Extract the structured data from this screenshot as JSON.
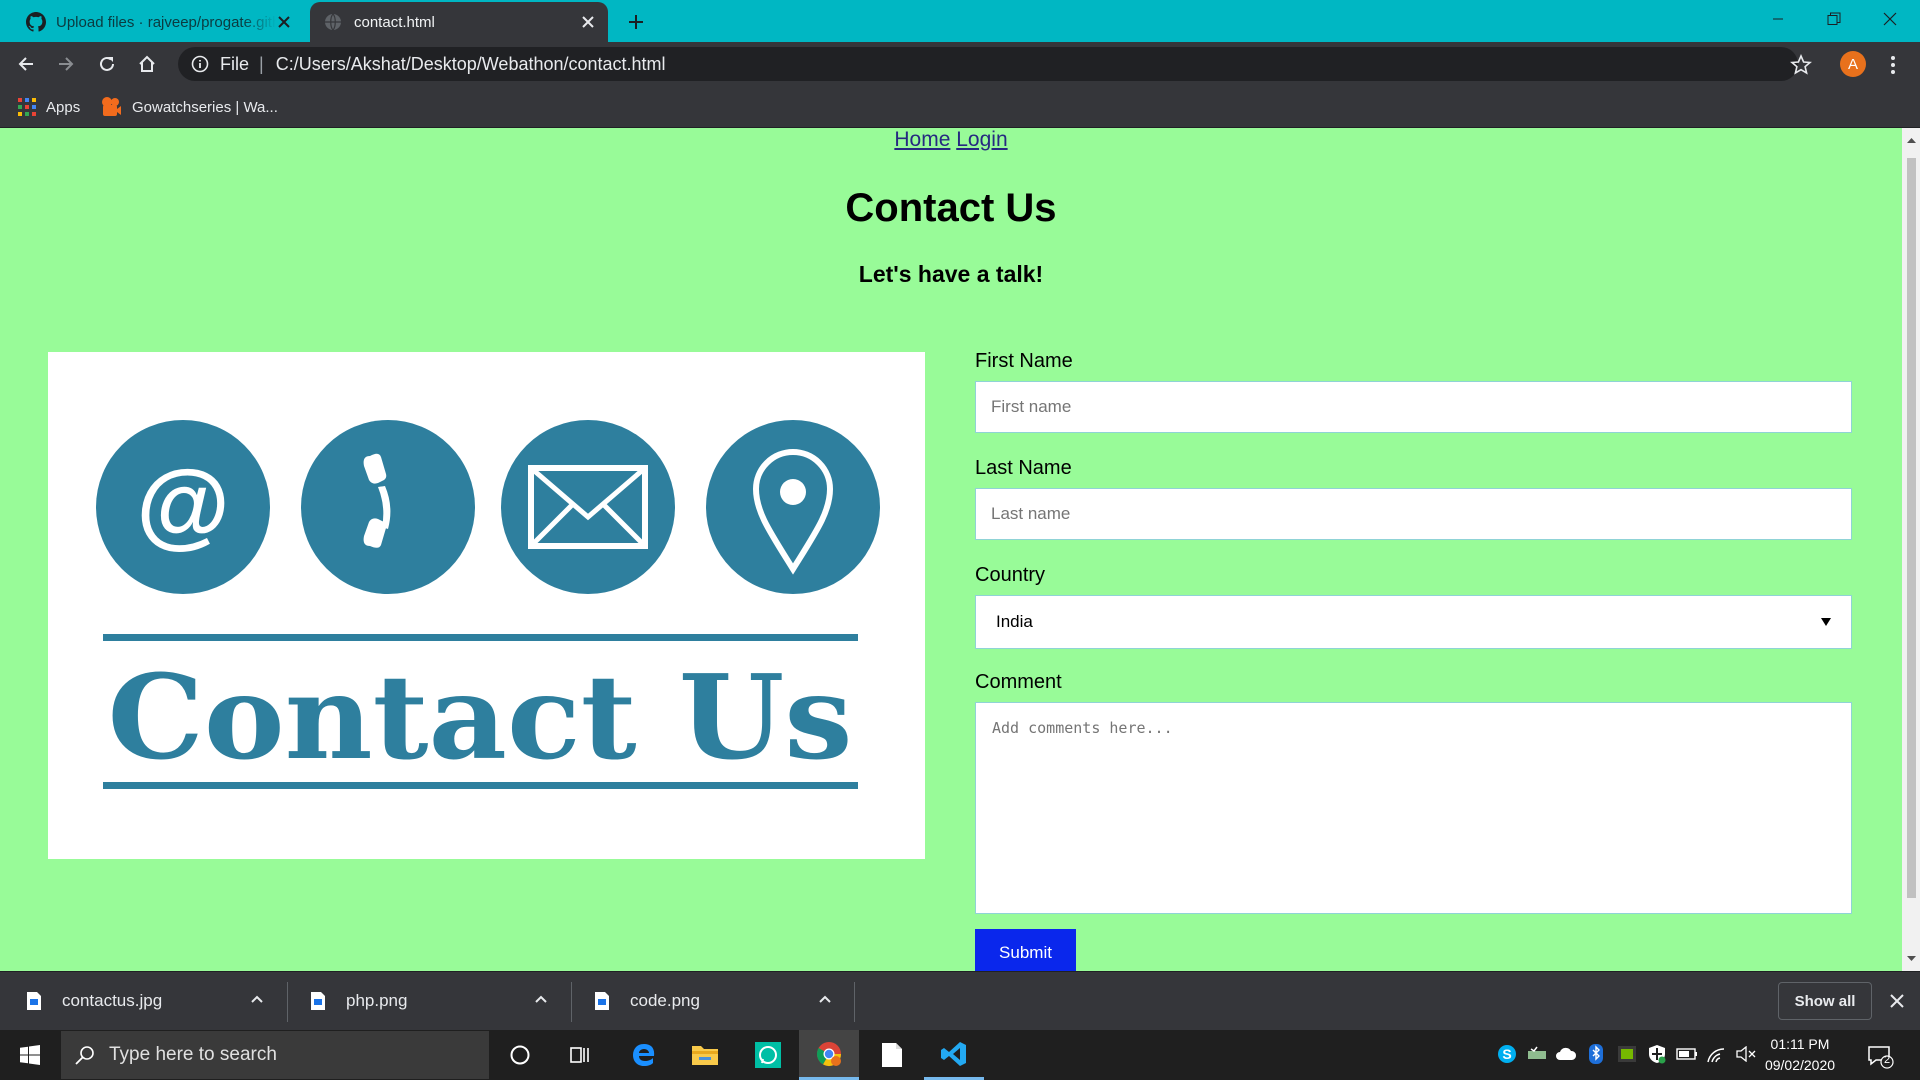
{
  "browser": {
    "tabs": [
      {
        "title": "Upload files · rajveep/progate.github.io",
        "active": false
      },
      {
        "title": "contact.html",
        "active": true
      }
    ],
    "address": {
      "scheme": "File",
      "url": "C:/Users/Akshat/Desktop/Webathon/contact.html"
    },
    "profile_initial": "A",
    "bookmarks": [
      {
        "label": "Apps",
        "icon": "apps-grid-icon"
      },
      {
        "label": "Gowatchseries | Wa...",
        "icon": "gowatchseries-icon"
      }
    ],
    "accent_color": "#00b7c3"
  },
  "page": {
    "background": "#98fb98",
    "nav": {
      "home": "Home",
      "login": "Login"
    },
    "title": "Contact Us",
    "subtitle": "Let's have a talk!",
    "image": {
      "banner_text": "Contact Us",
      "icons": [
        "at-sign-icon",
        "phone-icon",
        "envelope-icon",
        "location-pin-icon"
      ],
      "color": "#2e7f9e"
    },
    "form": {
      "first_name_label": "First Name",
      "first_name_placeholder": "First name",
      "last_name_label": "Last Name",
      "last_name_placeholder": "Last name",
      "country_label": "Country",
      "country_value": "India",
      "comment_label": "Comment",
      "comment_placeholder": "Add comments here...",
      "submit_label": "Submit"
    }
  },
  "downloads": {
    "items": [
      {
        "name": "contactus.jpg"
      },
      {
        "name": "php.png"
      },
      {
        "name": "code.png"
      }
    ],
    "show_all": "Show all"
  },
  "taskbar": {
    "search_placeholder": "Type here to search",
    "time": "01:11 PM",
    "date": "09/02/2020",
    "notifications": "2"
  }
}
